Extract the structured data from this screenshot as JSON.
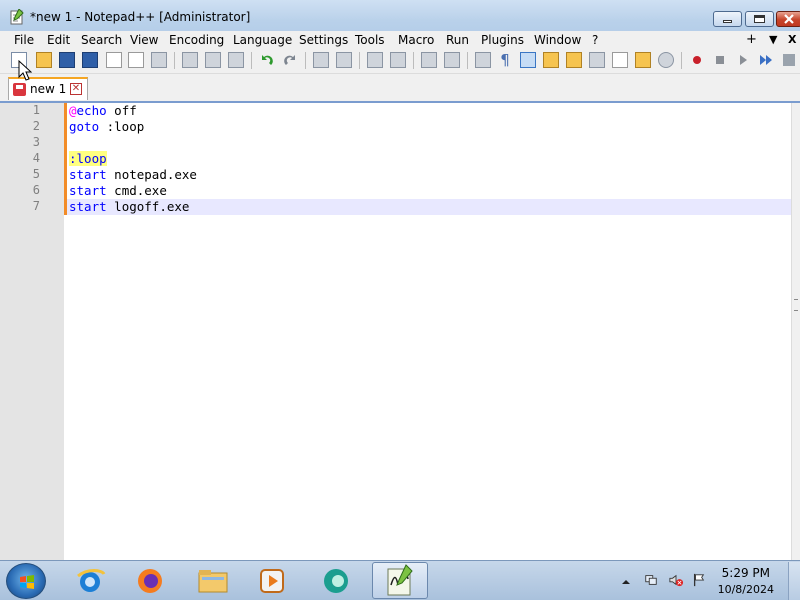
{
  "window": {
    "title": "*new 1 - Notepad++ [Administrator]"
  },
  "menu": {
    "items": [
      "File",
      "Edit",
      "Search",
      "View",
      "Encoding",
      "Language",
      "Settings",
      "Tools",
      "Macro",
      "Run",
      "Plugins",
      "Window",
      "?"
    ],
    "right_plus": "+",
    "right_arrow": "▼",
    "right_close": "X"
  },
  "tabs": [
    {
      "label": "new 1"
    }
  ],
  "editor": {
    "line_numbers": [
      "1",
      "2",
      "3",
      "4",
      "5",
      "6",
      "7"
    ],
    "lines": [
      {
        "parts": [
          {
            "text": "@",
            "cls": "at"
          },
          {
            "text": "echo",
            "cls": "kw"
          },
          {
            "text": " off",
            "cls": ""
          }
        ]
      },
      {
        "parts": [
          {
            "text": "goto",
            "cls": "kw"
          },
          {
            "text": " :loop",
            "cls": ""
          }
        ]
      },
      {
        "parts": []
      },
      {
        "parts": [
          {
            "text": ":loop",
            "cls": "label-hl"
          }
        ]
      },
      {
        "parts": [
          {
            "text": "start",
            "cls": "kw"
          },
          {
            "text": " notepad.exe",
            "cls": ""
          }
        ]
      },
      {
        "parts": [
          {
            "text": "start",
            "cls": "kw"
          },
          {
            "text": " cmd.exe",
            "cls": ""
          }
        ]
      },
      {
        "parts": [
          {
            "text": "start",
            "cls": "kw"
          },
          {
            "text": " logoff.exe",
            "cls": ""
          }
        ]
      }
    ],
    "current_line": 7
  },
  "taskbar": {
    "apps": [
      "internet-explorer",
      "firefox",
      "file-explorer",
      "media-player",
      "edge-like-browser",
      "notepad-plus-plus"
    ],
    "clock_time": "5:29 PM",
    "clock_date": "10/8/2024"
  },
  "colors": {
    "keyword": "#0000ff",
    "at_sign": "#ff00ff",
    "label_highlight": "#ffff80",
    "current_line": "#e8e8ff",
    "change_bar": "#f28c28"
  }
}
